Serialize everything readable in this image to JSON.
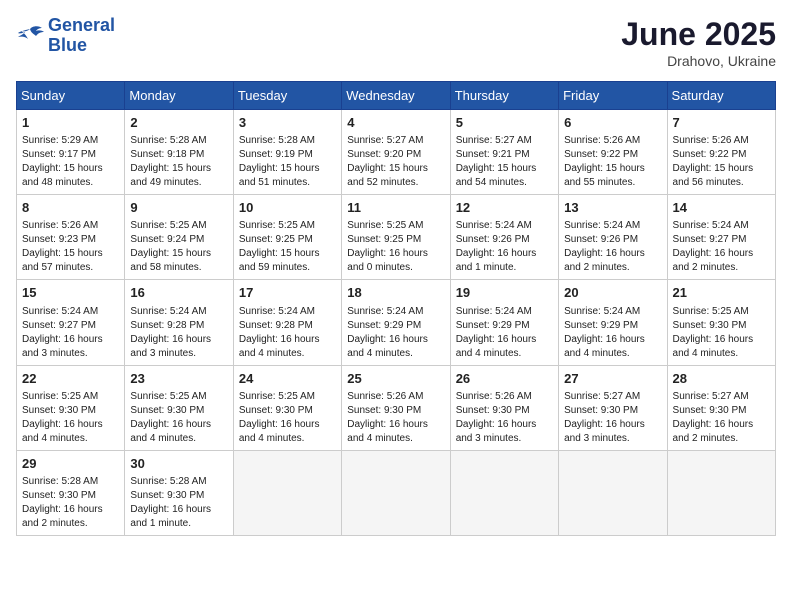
{
  "logo": {
    "line1": "General",
    "line2": "Blue"
  },
  "title": "June 2025",
  "location": "Drahovo, Ukraine",
  "weekdays": [
    "Sunday",
    "Monday",
    "Tuesday",
    "Wednesday",
    "Thursday",
    "Friday",
    "Saturday"
  ],
  "weeks": [
    [
      {
        "day": "1",
        "info": "Sunrise: 5:29 AM\nSunset: 9:17 PM\nDaylight: 15 hours\nand 48 minutes."
      },
      {
        "day": "2",
        "info": "Sunrise: 5:28 AM\nSunset: 9:18 PM\nDaylight: 15 hours\nand 49 minutes."
      },
      {
        "day": "3",
        "info": "Sunrise: 5:28 AM\nSunset: 9:19 PM\nDaylight: 15 hours\nand 51 minutes."
      },
      {
        "day": "4",
        "info": "Sunrise: 5:27 AM\nSunset: 9:20 PM\nDaylight: 15 hours\nand 52 minutes."
      },
      {
        "day": "5",
        "info": "Sunrise: 5:27 AM\nSunset: 9:21 PM\nDaylight: 15 hours\nand 54 minutes."
      },
      {
        "day": "6",
        "info": "Sunrise: 5:26 AM\nSunset: 9:22 PM\nDaylight: 15 hours\nand 55 minutes."
      },
      {
        "day": "7",
        "info": "Sunrise: 5:26 AM\nSunset: 9:22 PM\nDaylight: 15 hours\nand 56 minutes."
      }
    ],
    [
      {
        "day": "8",
        "info": "Sunrise: 5:26 AM\nSunset: 9:23 PM\nDaylight: 15 hours\nand 57 minutes."
      },
      {
        "day": "9",
        "info": "Sunrise: 5:25 AM\nSunset: 9:24 PM\nDaylight: 15 hours\nand 58 minutes."
      },
      {
        "day": "10",
        "info": "Sunrise: 5:25 AM\nSunset: 9:25 PM\nDaylight: 15 hours\nand 59 minutes."
      },
      {
        "day": "11",
        "info": "Sunrise: 5:25 AM\nSunset: 9:25 PM\nDaylight: 16 hours\nand 0 minutes."
      },
      {
        "day": "12",
        "info": "Sunrise: 5:24 AM\nSunset: 9:26 PM\nDaylight: 16 hours\nand 1 minute."
      },
      {
        "day": "13",
        "info": "Sunrise: 5:24 AM\nSunset: 9:26 PM\nDaylight: 16 hours\nand 2 minutes."
      },
      {
        "day": "14",
        "info": "Sunrise: 5:24 AM\nSunset: 9:27 PM\nDaylight: 16 hours\nand 2 minutes."
      }
    ],
    [
      {
        "day": "15",
        "info": "Sunrise: 5:24 AM\nSunset: 9:27 PM\nDaylight: 16 hours\nand 3 minutes."
      },
      {
        "day": "16",
        "info": "Sunrise: 5:24 AM\nSunset: 9:28 PM\nDaylight: 16 hours\nand 3 minutes."
      },
      {
        "day": "17",
        "info": "Sunrise: 5:24 AM\nSunset: 9:28 PM\nDaylight: 16 hours\nand 4 minutes."
      },
      {
        "day": "18",
        "info": "Sunrise: 5:24 AM\nSunset: 9:29 PM\nDaylight: 16 hours\nand 4 minutes."
      },
      {
        "day": "19",
        "info": "Sunrise: 5:24 AM\nSunset: 9:29 PM\nDaylight: 16 hours\nand 4 minutes."
      },
      {
        "day": "20",
        "info": "Sunrise: 5:24 AM\nSunset: 9:29 PM\nDaylight: 16 hours\nand 4 minutes."
      },
      {
        "day": "21",
        "info": "Sunrise: 5:25 AM\nSunset: 9:30 PM\nDaylight: 16 hours\nand 4 minutes."
      }
    ],
    [
      {
        "day": "22",
        "info": "Sunrise: 5:25 AM\nSunset: 9:30 PM\nDaylight: 16 hours\nand 4 minutes."
      },
      {
        "day": "23",
        "info": "Sunrise: 5:25 AM\nSunset: 9:30 PM\nDaylight: 16 hours\nand 4 minutes."
      },
      {
        "day": "24",
        "info": "Sunrise: 5:25 AM\nSunset: 9:30 PM\nDaylight: 16 hours\nand 4 minutes."
      },
      {
        "day": "25",
        "info": "Sunrise: 5:26 AM\nSunset: 9:30 PM\nDaylight: 16 hours\nand 4 minutes."
      },
      {
        "day": "26",
        "info": "Sunrise: 5:26 AM\nSunset: 9:30 PM\nDaylight: 16 hours\nand 3 minutes."
      },
      {
        "day": "27",
        "info": "Sunrise: 5:27 AM\nSunset: 9:30 PM\nDaylight: 16 hours\nand 3 minutes."
      },
      {
        "day": "28",
        "info": "Sunrise: 5:27 AM\nSunset: 9:30 PM\nDaylight: 16 hours\nand 2 minutes."
      }
    ],
    [
      {
        "day": "29",
        "info": "Sunrise: 5:28 AM\nSunset: 9:30 PM\nDaylight: 16 hours\nand 2 minutes."
      },
      {
        "day": "30",
        "info": "Sunrise: 5:28 AM\nSunset: 9:30 PM\nDaylight: 16 hours\nand 1 minute."
      },
      null,
      null,
      null,
      null,
      null
    ]
  ]
}
